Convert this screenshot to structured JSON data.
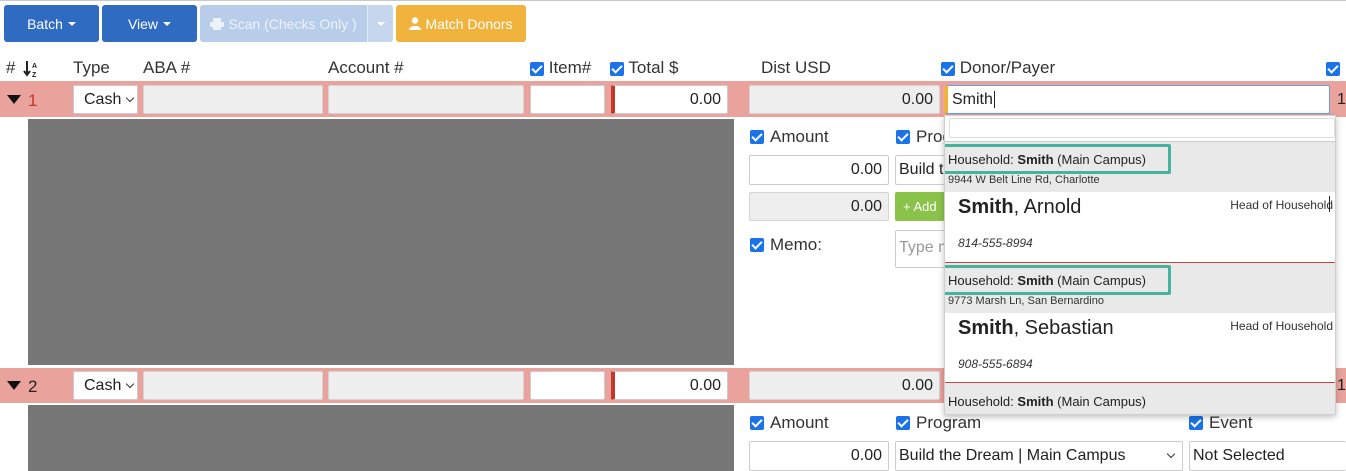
{
  "toolbar": {
    "batch_label": "Batch",
    "view_label": "View",
    "scan_label": "Scan (Checks Only )",
    "match_label": "Match Donors"
  },
  "columns": {
    "num": "#",
    "type": "Type",
    "aba": "ABA #",
    "account": "Account #",
    "item": "Item#",
    "total": "Total $",
    "dist": "Dist USD",
    "donor": "Donor/Payer"
  },
  "rows": [
    {
      "num": "1",
      "type": "Cash",
      "total": "0.00",
      "dist": "0.00",
      "donor": "Smith",
      "trailing": "1",
      "detail": {
        "amount_label": "Amount",
        "program_label": "Prog",
        "amount_value": "0.00",
        "amount_value2": "0.00",
        "program_value": "Build t",
        "add_label": "+ Add",
        "memo_label": "Memo:",
        "memo_placeholder": "Type m"
      }
    },
    {
      "num": "2",
      "type": "Cash",
      "total": "0.00",
      "dist": "0.00",
      "trailing": "1",
      "detail": {
        "amount_label": "Amount",
        "program_label": "Program",
        "event_label": "Event",
        "amount_value": "0.00",
        "program_value": "Build the Dream | Main Campus",
        "event_value": "Not Selected"
      }
    }
  ],
  "dropdown": {
    "household_prefix": "Household:",
    "results": [
      {
        "household_name": "Smith",
        "campus": "(Main Campus)",
        "address": "9944 W Belt Line Rd, Charlotte",
        "last": "Smith",
        "first": ", Arnold",
        "role": "Head of Household",
        "phone": "814-555-8994"
      },
      {
        "household_name": "Smith",
        "campus": "(Main Campus)",
        "address": "9773 Marsh Ln, San Bernardino",
        "last": "Smith",
        "first": ", Sebastian",
        "role": "Head of Household",
        "phone": "908-555-6894"
      },
      {
        "household_name": "Smith",
        "campus": "(Main Campus)"
      }
    ]
  },
  "colors": {
    "primary": "#2f6bc0",
    "warning": "#f0b33d",
    "row_band": "#eaa39c",
    "highlight": "#45b39d"
  }
}
